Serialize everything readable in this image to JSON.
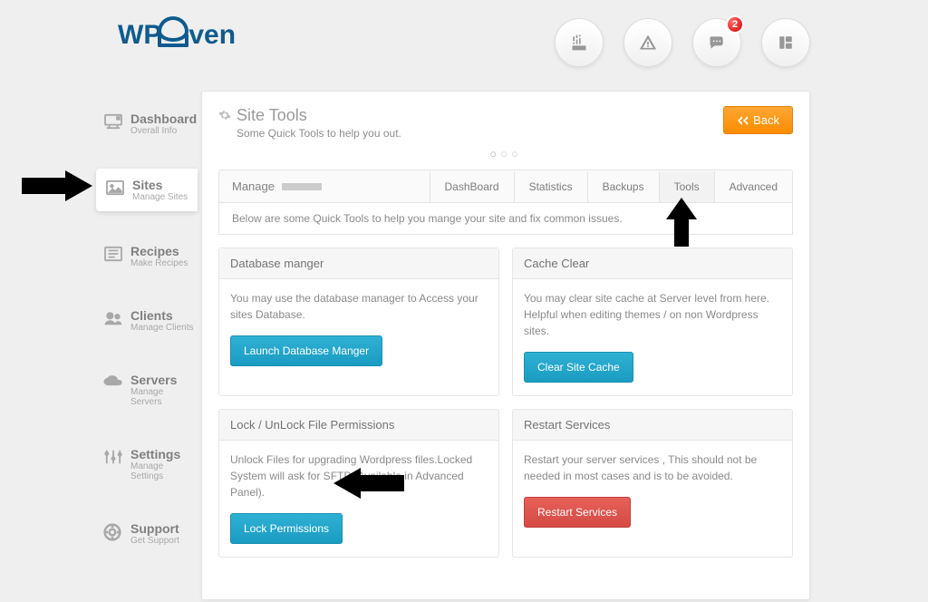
{
  "logo": {
    "text_a": "WP",
    "text_b": "ven"
  },
  "header": {
    "notifications_badge": "2"
  },
  "sidebar": {
    "items": [
      {
        "title": "Dashboard",
        "sub": "Overall Info"
      },
      {
        "title": "Sites",
        "sub": "Manage Sites"
      },
      {
        "title": "Recipes",
        "sub": "Make Recipes"
      },
      {
        "title": "Clients",
        "sub": "Manage Clients"
      },
      {
        "title": "Servers",
        "sub": "Manage Servers"
      },
      {
        "title": "Settings",
        "sub": "Manage Settings"
      },
      {
        "title": "Support",
        "sub": "Get Support"
      }
    ]
  },
  "panel": {
    "title": "Site Tools",
    "subtitle": "Some Quick Tools to help you out.",
    "back_label": "Back"
  },
  "tabbar": {
    "manage_label": "Manage",
    "desc": "Below are some Quick Tools to help you mange your site and fix common issues.",
    "tabs": [
      {
        "label": "DashBoard"
      },
      {
        "label": "Statistics"
      },
      {
        "label": "Backups"
      },
      {
        "label": "Tools"
      },
      {
        "label": "Advanced"
      }
    ]
  },
  "cards": [
    {
      "title": "Database manger",
      "body": "You may use the database manager to Access your sites Database.",
      "button": "Launch Database Manger",
      "style": "blue"
    },
    {
      "title": "Cache Clear",
      "body": "You may clear site cache at Server level from here. Helpful when editing themes / on non Wordpress sites.",
      "button": "Clear Site Cache",
      "style": "blue"
    },
    {
      "title": "Lock / UnLock File Permissions",
      "body": "Unlock Files for upgrading Wordpress files.Locked System will ask for SFTP (Available in Advanced Panel).",
      "button": "Lock Permissions",
      "style": "blue"
    },
    {
      "title": "Restart Services",
      "body": "Restart your server services , This should not be needed in most cases and is to be avoided.",
      "button": "Restart Services",
      "style": "red"
    }
  ]
}
